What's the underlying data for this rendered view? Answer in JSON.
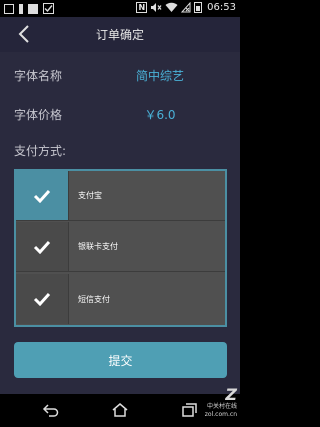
{
  "status_bar": {
    "time": "06:53",
    "icons": [
      "notification-icon",
      "notification-bar-icon",
      "notification-filled-icon",
      "check-icon",
      "nfc-icon",
      "mute-icon",
      "wifi-icon",
      "no-sim-icon",
      "battery-icon"
    ],
    "nfc_text": "N"
  },
  "header": {
    "title": "订单确定",
    "back_icon": "chevron-left-icon"
  },
  "order": {
    "font_name_label": "字体名称",
    "font_name_value": "简中综艺",
    "font_price_label": "字体价格",
    "font_price_value": "￥6.0",
    "payment_label": "支付方式:"
  },
  "payment_options": [
    {
      "label": "支付宝",
      "selected": true
    },
    {
      "label": "银联卡支付",
      "selected": false
    },
    {
      "label": "短信支付",
      "selected": false
    }
  ],
  "submit_label": "提交",
  "nav": {
    "back_icon": "back-arrow-icon",
    "home_icon": "home-icon",
    "recents_icon": "recents-icon"
  },
  "watermark": {
    "logo": "Z",
    "line1": "中关村在线",
    "line2": "zol.com.cn"
  },
  "colors": {
    "accent": "#4f9fb4",
    "value_text": "#4ab2d8",
    "background": "#2a2a3e",
    "selected_check": "#4b8fa3"
  }
}
